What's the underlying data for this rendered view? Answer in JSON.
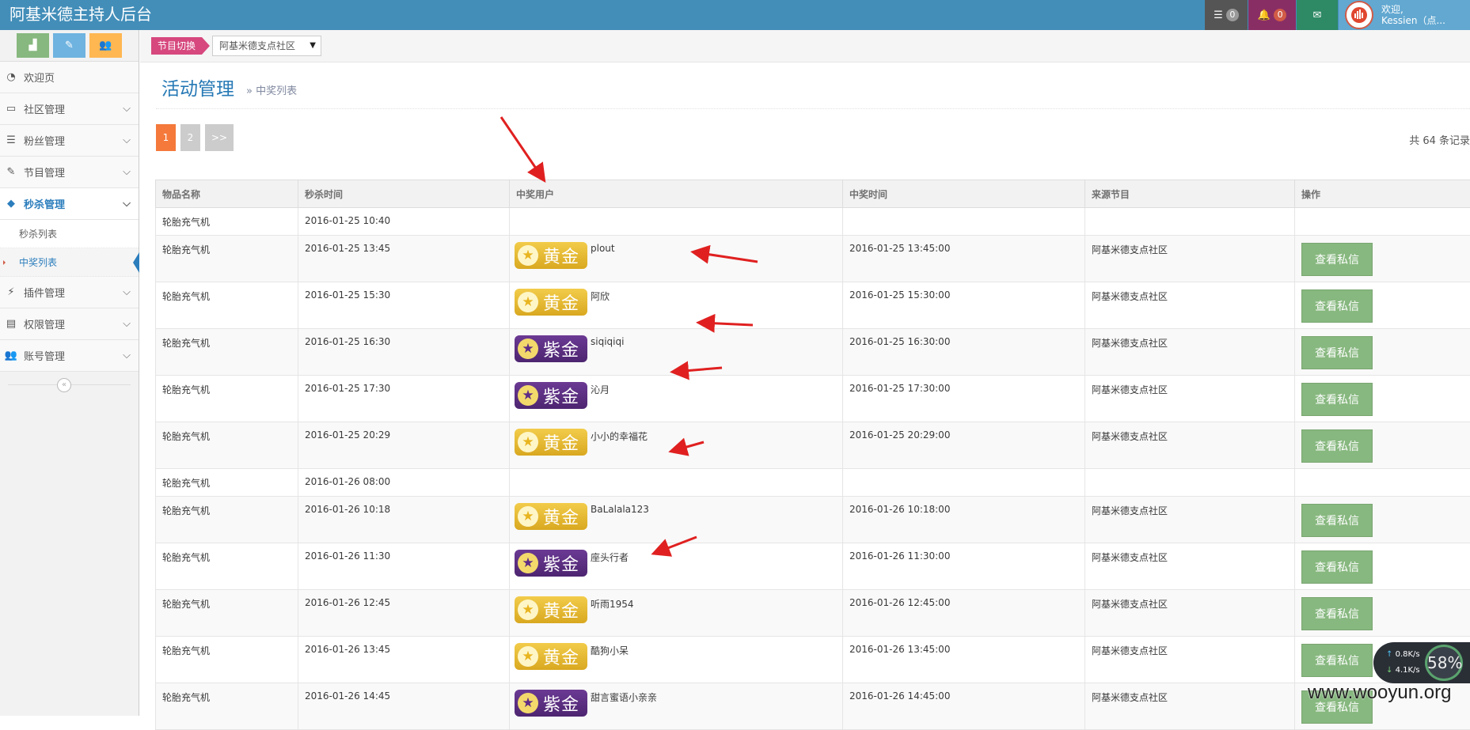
{
  "app": {
    "title": "阿基米德主持人后台"
  },
  "topbar": {
    "tasks_count": "0",
    "notifications_count": "0",
    "welcome": "欢迎,",
    "username": "Kessien（点..."
  },
  "sidebar": {
    "items": [
      {
        "label": "欢迎页",
        "icon": "dashboard-icon"
      },
      {
        "label": "社区管理",
        "icon": "desktop-icon"
      },
      {
        "label": "粉丝管理",
        "icon": "list-icon"
      },
      {
        "label": "节目管理",
        "icon": "edit-icon"
      },
      {
        "label": "秒杀管理",
        "icon": "tag-icon"
      },
      {
        "label": "插件管理",
        "icon": "plug-icon"
      },
      {
        "label": "权限管理",
        "icon": "list-alt-icon"
      },
      {
        "label": "账号管理",
        "icon": "users-icon"
      }
    ],
    "subitems": [
      {
        "label": "秒杀列表"
      },
      {
        "label": "中奖列表"
      }
    ]
  },
  "breadcrumb": {
    "switch_label": "节目切换",
    "program_selected": "阿基米德支点社区"
  },
  "page": {
    "title": "活动管理",
    "subtitle": "中奖列表",
    "pagination": [
      "1",
      "2",
      ">>"
    ],
    "total": "共 64 条记录"
  },
  "table": {
    "headers": [
      "物品名称",
      "秒杀时间",
      "中奖用户",
      "中奖时间",
      "来源节目",
      "操作"
    ],
    "action_label": "查看私信",
    "rows": [
      {
        "item": "轮胎充气机",
        "flash_time": "2016-01-25 10:40",
        "vip": "",
        "user": "",
        "win_time": "",
        "source": ""
      },
      {
        "item": "轮胎充气机",
        "flash_time": "2016-01-25 13:45",
        "vip": "黄金",
        "user": "plout",
        "win_time": "2016-01-25 13:45:00",
        "source": "阿基米德支点社区"
      },
      {
        "item": "轮胎充气机",
        "flash_time": "2016-01-25 15:30",
        "vip": "黄金",
        "user": "阿欣",
        "win_time": "2016-01-25 15:30:00",
        "source": "阿基米德支点社区"
      },
      {
        "item": "轮胎充气机",
        "flash_time": "2016-01-25 16:30",
        "vip": "紫金",
        "user": "siqiqiqi",
        "win_time": "2016-01-25 16:30:00",
        "source": "阿基米德支点社区"
      },
      {
        "item": "轮胎充气机",
        "flash_time": "2016-01-25 17:30",
        "vip": "紫金",
        "user": "沁月",
        "win_time": "2016-01-25 17:30:00",
        "source": "阿基米德支点社区"
      },
      {
        "item": "轮胎充气机",
        "flash_time": "2016-01-25 20:29",
        "vip": "黄金",
        "user": "小小的幸福花",
        "win_time": "2016-01-25 20:29:00",
        "source": "阿基米德支点社区"
      },
      {
        "item": "轮胎充气机",
        "flash_time": "2016-01-26 08:00",
        "vip": "",
        "user": "",
        "win_time": "",
        "source": ""
      },
      {
        "item": "轮胎充气机",
        "flash_time": "2016-01-26 10:18",
        "vip": "黄金",
        "user": "BaLalala123",
        "win_time": "2016-01-26 10:18:00",
        "source": "阿基米德支点社区"
      },
      {
        "item": "轮胎充气机",
        "flash_time": "2016-01-26 11:30",
        "vip": "紫金",
        "user": "座头行者",
        "win_time": "2016-01-26 11:30:00",
        "source": "阿基米德支点社区"
      },
      {
        "item": "轮胎充气机",
        "flash_time": "2016-01-26 12:45",
        "vip": "黄金",
        "user": "听雨1954",
        "win_time": "2016-01-26 12:45:00",
        "source": "阿基米德支点社区"
      },
      {
        "item": "轮胎充气机",
        "flash_time": "2016-01-26 13:45",
        "vip": "黄金",
        "user": "酷狗小呆",
        "win_time": "2016-01-26 13:45:00",
        "source": "阿基米德支点社区"
      },
      {
        "item": "轮胎充气机",
        "flash_time": "2016-01-26 14:45",
        "vip": "紫金",
        "user": "甜言蜜语小亲亲",
        "win_time": "2016-01-26 14:45:00",
        "source": "阿基米德支点社区"
      }
    ]
  },
  "overlay": {
    "upload_speed": "0.8K/s",
    "download_speed": "4.1K/s",
    "percent": "58%",
    "watermark": "www.wooyun.org"
  },
  "colors": {
    "navbar": "#438eb9",
    "accent_blue": "#2679b5",
    "active_page": "#f4793b",
    "action_green": "#87b87f",
    "annotation_red": "#e02020"
  }
}
